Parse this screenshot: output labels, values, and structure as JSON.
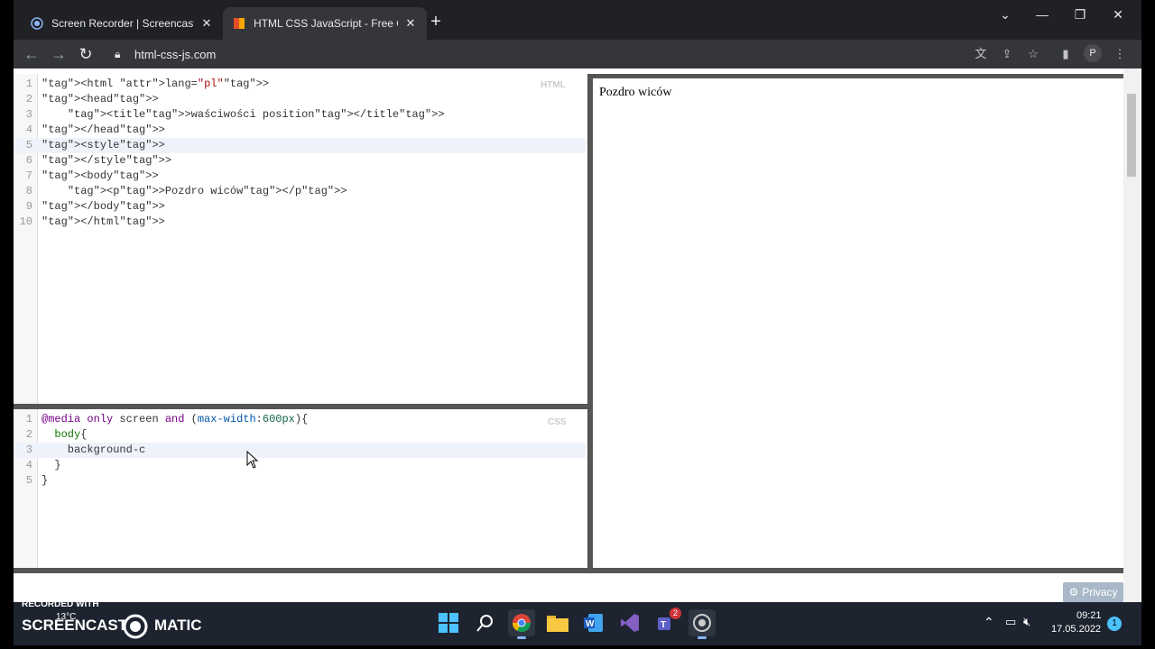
{
  "browser": {
    "tabs": [
      {
        "title": "Screen Recorder | Screencast-O-Matic",
        "active": false,
        "icon": "screencast-icon"
      },
      {
        "title": "HTML CSS JavaScript - Free Online Editor",
        "active": true,
        "icon": "html-css-js-icon"
      }
    ],
    "new_tab_label": "+",
    "url": "html-css-js.com",
    "profile_initial": "P"
  },
  "editor": {
    "html_badge": "HTML",
    "css_badge": "CSS",
    "html_lines": [
      {
        "n": "1",
        "text": "<html lang=\"pl\">"
      },
      {
        "n": "2",
        "text": "<head>"
      },
      {
        "n": "3",
        "text": "    <title>waściwości position</title>"
      },
      {
        "n": "4",
        "text": "</head>"
      },
      {
        "n": "5",
        "text": "<style>"
      },
      {
        "n": "6",
        "text": "</style>"
      },
      {
        "n": "7",
        "text": "<body>"
      },
      {
        "n": "8",
        "text": "    <p>Pozdro wiców</p>"
      },
      {
        "n": "9",
        "text": "</body>"
      },
      {
        "n": "10",
        "text": "</html>"
      }
    ],
    "css_lines": [
      {
        "n": "1",
        "text": "@media only screen and (max-width:600px){"
      },
      {
        "n": "2",
        "text": "  body{"
      },
      {
        "n": "3",
        "text": "    background-c"
      },
      {
        "n": "4",
        "text": "  }"
      },
      {
        "n": "5",
        "text": "}"
      }
    ]
  },
  "preview": {
    "text": "Pozdro wiców"
  },
  "privacy_label": "Privacy",
  "taskbar": {
    "weather": "13°C",
    "time": "09:21",
    "date": "17.05.2022",
    "notification_count": "1",
    "teams_badge": "2"
  },
  "watermark": {
    "line1": "RECORDED WITH",
    "brand_left": "SCREENCAST",
    "brand_right": "MATIC"
  },
  "colors": {
    "chrome_dark": "#202124",
    "toolbar": "#35363a",
    "taskbar": "#1d2430",
    "pane_border": "#555555"
  }
}
